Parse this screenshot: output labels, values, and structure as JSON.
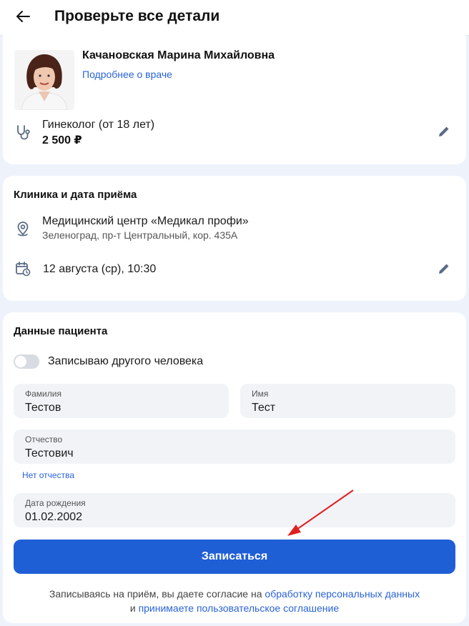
{
  "header": {
    "title": "Проверьте все детали",
    "back_icon": "arrow-left-icon"
  },
  "doctor": {
    "name": "Качановская Марина Михайловна",
    "more_link": "Подробнее о враче",
    "specialty": "Гинеколог  (от 18 лет)",
    "price": "2 500 ₽"
  },
  "clinic": {
    "section_title": "Клиника и дата приёма",
    "name": "Медицинский центр «Медикал профи»",
    "address": "Зеленоград, пр-т Центральный, кор. 435А",
    "datetime": "12 августа (ср), 10:30"
  },
  "patient": {
    "section_title": "Данные пациента",
    "toggle_label": "Записываю другого человека",
    "toggle_on": false,
    "fields": {
      "surname": {
        "label": "Фамилия",
        "value": "Тестов"
      },
      "name": {
        "label": "Имя",
        "value": "Тест"
      },
      "patronymic": {
        "label": "Отчество",
        "value": "Тестович"
      },
      "birthdate": {
        "label": "Дата рождения",
        "value": "01.02.2002"
      }
    },
    "no_patronymic_link": "Нет отчества"
  },
  "submit_label": "Записаться",
  "consent": {
    "text1": "Записываясь на приём, вы даете согласие на ",
    "link1": "обработку персональных данных",
    "text2": "и ",
    "link2": "принимаете пользовательское соглашение"
  },
  "colors": {
    "accent": "#1f5fd6",
    "link": "#2a63d8",
    "background": "#eef2fb",
    "annotation_arrow": "#e02020"
  }
}
